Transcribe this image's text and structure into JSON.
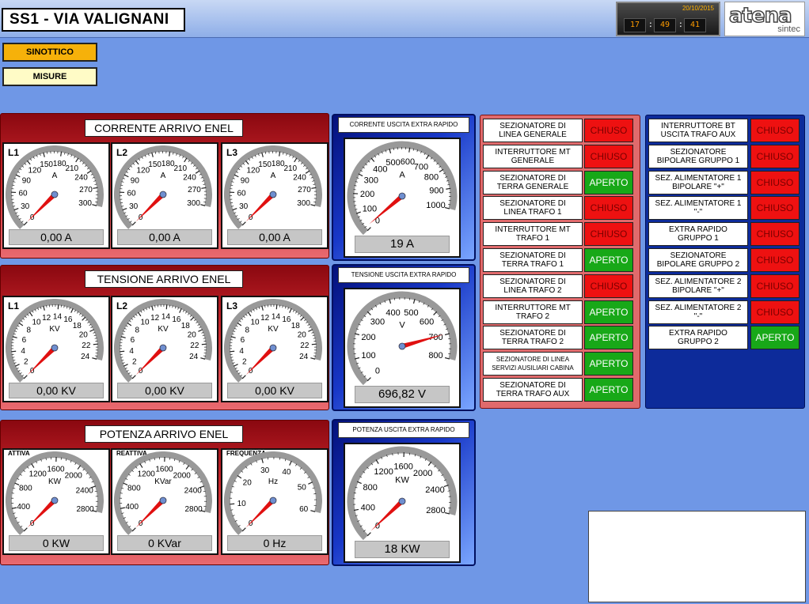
{
  "header": {
    "title": "SS1 - VIA VALIGNANI",
    "clock": {
      "date": "20/10/2015",
      "hh": "17",
      "mm": "49",
      "ss": "41"
    },
    "logo": {
      "brand": "atena",
      "sub": "sintec"
    }
  },
  "nav": {
    "sinottico": "SINOTTICO",
    "misure": "MISURE"
  },
  "sections": {
    "corrente": "CORRENTE ARRIVO ENEL",
    "tensione": "TENSIONE ARRIVO ENEL",
    "potenza": "POTENZA ARRIVO ENEL"
  },
  "gauges": {
    "corrente": [
      {
        "label": "L1",
        "unit": "A",
        "value": "0,00 A",
        "ticks": [
          "0",
          "30",
          "60",
          "90",
          "120",
          "150",
          "180",
          "210",
          "240",
          "270",
          "300"
        ],
        "level": 0
      },
      {
        "label": "L2",
        "unit": "A",
        "value": "0,00 A",
        "ticks": [
          "0",
          "30",
          "60",
          "90",
          "120",
          "150",
          "180",
          "210",
          "240",
          "270",
          "300"
        ],
        "level": 0
      },
      {
        "label": "L3",
        "unit": "A",
        "value": "0,00 A",
        "ticks": [
          "0",
          "30",
          "60",
          "90",
          "120",
          "150",
          "180",
          "210",
          "240",
          "270",
          "300"
        ],
        "level": 0
      }
    ],
    "tensione": [
      {
        "label": "L1",
        "unit": "KV",
        "value": "0,00 KV",
        "ticks": [
          "0",
          "2",
          "4",
          "6",
          "8",
          "10",
          "12",
          "14",
          "16",
          "18",
          "20",
          "22",
          "24"
        ],
        "level": 0
      },
      {
        "label": "L2",
        "unit": "KV",
        "value": "0,00 KV",
        "ticks": [
          "0",
          "2",
          "4",
          "6",
          "8",
          "10",
          "12",
          "14",
          "16",
          "18",
          "20",
          "22",
          "24"
        ],
        "level": 0
      },
      {
        "label": "L3",
        "unit": "KV",
        "value": "0,00 KV",
        "ticks": [
          "0",
          "2",
          "4",
          "6",
          "8",
          "10",
          "12",
          "14",
          "16",
          "18",
          "20",
          "22",
          "24"
        ],
        "level": 0
      }
    ],
    "potenza": [
      {
        "label": "ATTIVA",
        "unit": "KW",
        "value": "0 KW",
        "ticks": [
          "0",
          "400",
          "800",
          "1200",
          "1600",
          "2000",
          "2400",
          "2800"
        ],
        "level": 0
      },
      {
        "label": "REATTIVA",
        "unit": "KVar",
        "value": "0 KVar",
        "ticks": [
          "0",
          "400",
          "800",
          "1200",
          "1600",
          "2000",
          "2400",
          "2800"
        ],
        "level": 0
      },
      {
        "label": "FREQUENZA",
        "unit": "Hz",
        "value": "0 Hz",
        "ticks": [
          "0",
          "10",
          "20",
          "30",
          "40",
          "50",
          "60"
        ],
        "level": 0
      }
    ],
    "extra": [
      {
        "title": "CORRENTE USCITA EXTRA RAPIDO",
        "unit": "A",
        "value": "19 A",
        "ticks": [
          "0",
          "100",
          "200",
          "300",
          "400",
          "500",
          "600",
          "700",
          "800",
          "900",
          "1000"
        ],
        "level": 0.019
      },
      {
        "title": "TENSIONE USCITA EXTRA RAPIDO",
        "unit": "V",
        "value": "696,82 V",
        "ticks": [
          "0",
          "100",
          "200",
          "300",
          "400",
          "500",
          "600",
          "700",
          "800"
        ],
        "level": 0.871
      },
      {
        "title": "POTENZA USCITA EXTRA RAPIDO",
        "unit": "KW",
        "value": "18 KW",
        "ticks": [
          "0",
          "400",
          "800",
          "1200",
          "1600",
          "2000",
          "2400",
          "2800"
        ],
        "level": 0.006
      }
    ]
  },
  "switches_left": [
    {
      "name": "SEZIONATORE DI\nLINEA GENERALE",
      "state": "CHIUSO",
      "status": "c"
    },
    {
      "name": "INTERRUTTORE MT\nGENERALE",
      "state": "CHIUSO",
      "status": "c"
    },
    {
      "name": "SEZIONATORE DI\nTERRA GENERALE",
      "state": "APERTO",
      "status": "a"
    },
    {
      "name": "SEZIONATORE DI\nLINEA TRAFO 1",
      "state": "CHIUSO",
      "status": "c"
    },
    {
      "name": "INTERRUTTORE MT\nTRAFO 1",
      "state": "CHIUSO",
      "status": "c"
    },
    {
      "name": "SEZIONATORE DI\nTERRA TRAFO 1",
      "state": "APERTO",
      "status": "a"
    },
    {
      "name": "SEZIONATORE DI\nLINEA TRAFO 2",
      "state": "CHIUSO",
      "status": "c"
    },
    {
      "name": "INTERRUTTORE MT\nTRAFO 2",
      "state": "APERTO",
      "status": "a"
    },
    {
      "name": "SEZIONATORE DI\nTERRA TRAFO 2",
      "state": "APERTO",
      "status": "a"
    },
    {
      "name": "SEZIONATORE DI LINEA\nSERVIZI AUSILIARI CABINA",
      "state": "APERTO",
      "status": "a",
      "tiny": true
    },
    {
      "name": "SEZIONATORE DI\nTERRA TRAFO AUX",
      "state": "APERTO",
      "status": "a"
    }
  ],
  "switches_right": [
    {
      "name": "INTERRUTTORE BT\nUSCITA TRAFO AUX",
      "state": "CHIUSO",
      "status": "c"
    },
    {
      "name": "SEZIONATORE\nBIPOLARE  GRUPPO 1",
      "state": "CHIUSO",
      "status": "c"
    },
    {
      "name": "SEZ. ALIMENTATORE 1\nBIPOLARE     \"+\"",
      "state": "CHIUSO",
      "status": "c"
    },
    {
      "name": "SEZ. ALIMENTATORE 1\n\"-\"",
      "state": "CHIUSO",
      "status": "c"
    },
    {
      "name": "EXTRA RAPIDO\nGRUPPO 1",
      "state": "CHIUSO",
      "status": "c"
    },
    {
      "name": "SEZIONATORE\nBIPOLARE GRUPPO 2",
      "state": "CHIUSO",
      "status": "c"
    },
    {
      "name": "SEZ. ALIMENTATORE 2\nBIPOLARE     \"+\"",
      "state": "CHIUSO",
      "status": "c"
    },
    {
      "name": "SEZ. ALIMENTATORE 2\n\"-\"",
      "state": "CHIUSO",
      "status": "c"
    },
    {
      "name": "EXTRA RAPIDO\nGRUPPO 2",
      "state": "APERTO",
      "status": "a"
    }
  ]
}
